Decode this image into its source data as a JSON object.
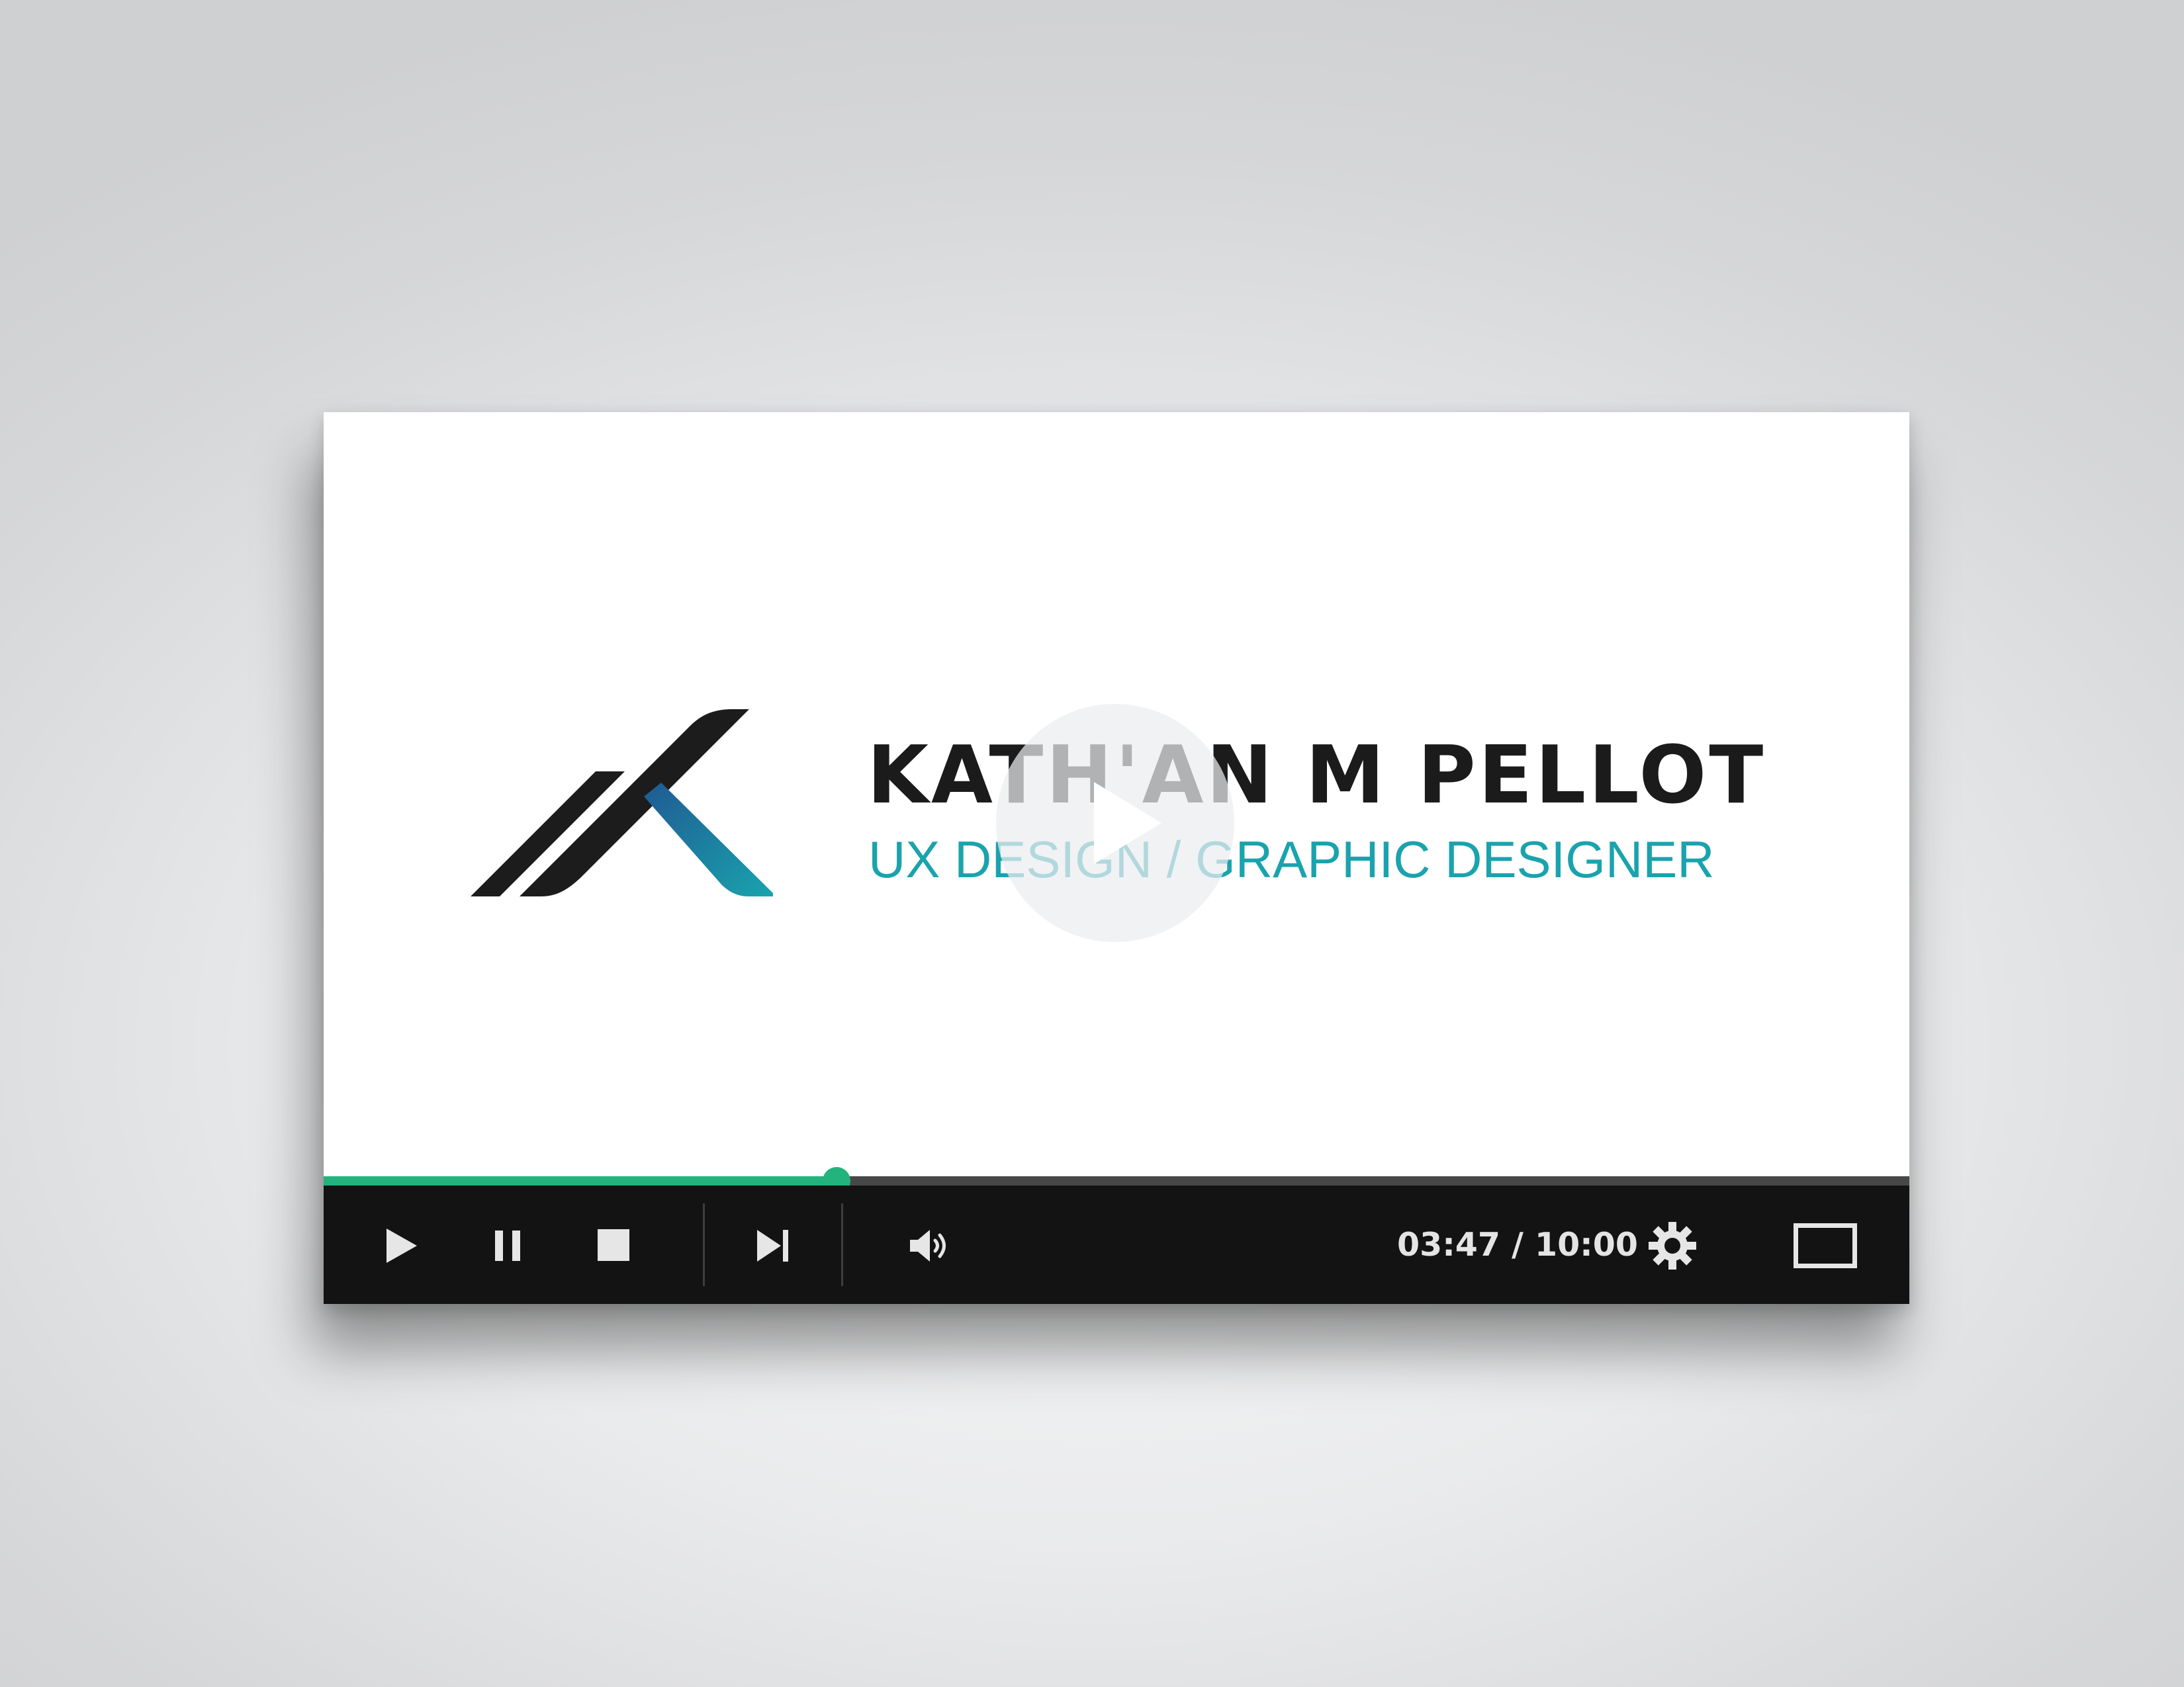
{
  "video": {
    "title": "KATH'AN M PELLOT",
    "subtitle": "UX DESIGN / GRAPHIC DESIGNER"
  },
  "icons": {
    "logo": "k-monogram-logo",
    "big_play": "play-icon",
    "play": "play-icon",
    "pause": "pause-icon",
    "stop": "stop-icon",
    "next": "skip-next-icon",
    "volume": "volume-icon",
    "settings": "gear-icon",
    "fullscreen": "fullscreen-icon"
  },
  "playback": {
    "current_time": "03:47",
    "separator": "/",
    "duration": "10:00",
    "time_display": "03:47 / 10:00",
    "progress_fraction": 0.3235
  },
  "colors": {
    "accent": "#23b47e",
    "subtitle": "#1aa3ad",
    "logo_blue": "#1f7fa6",
    "control_bar": "#131313",
    "title": "#1b1b1b"
  }
}
